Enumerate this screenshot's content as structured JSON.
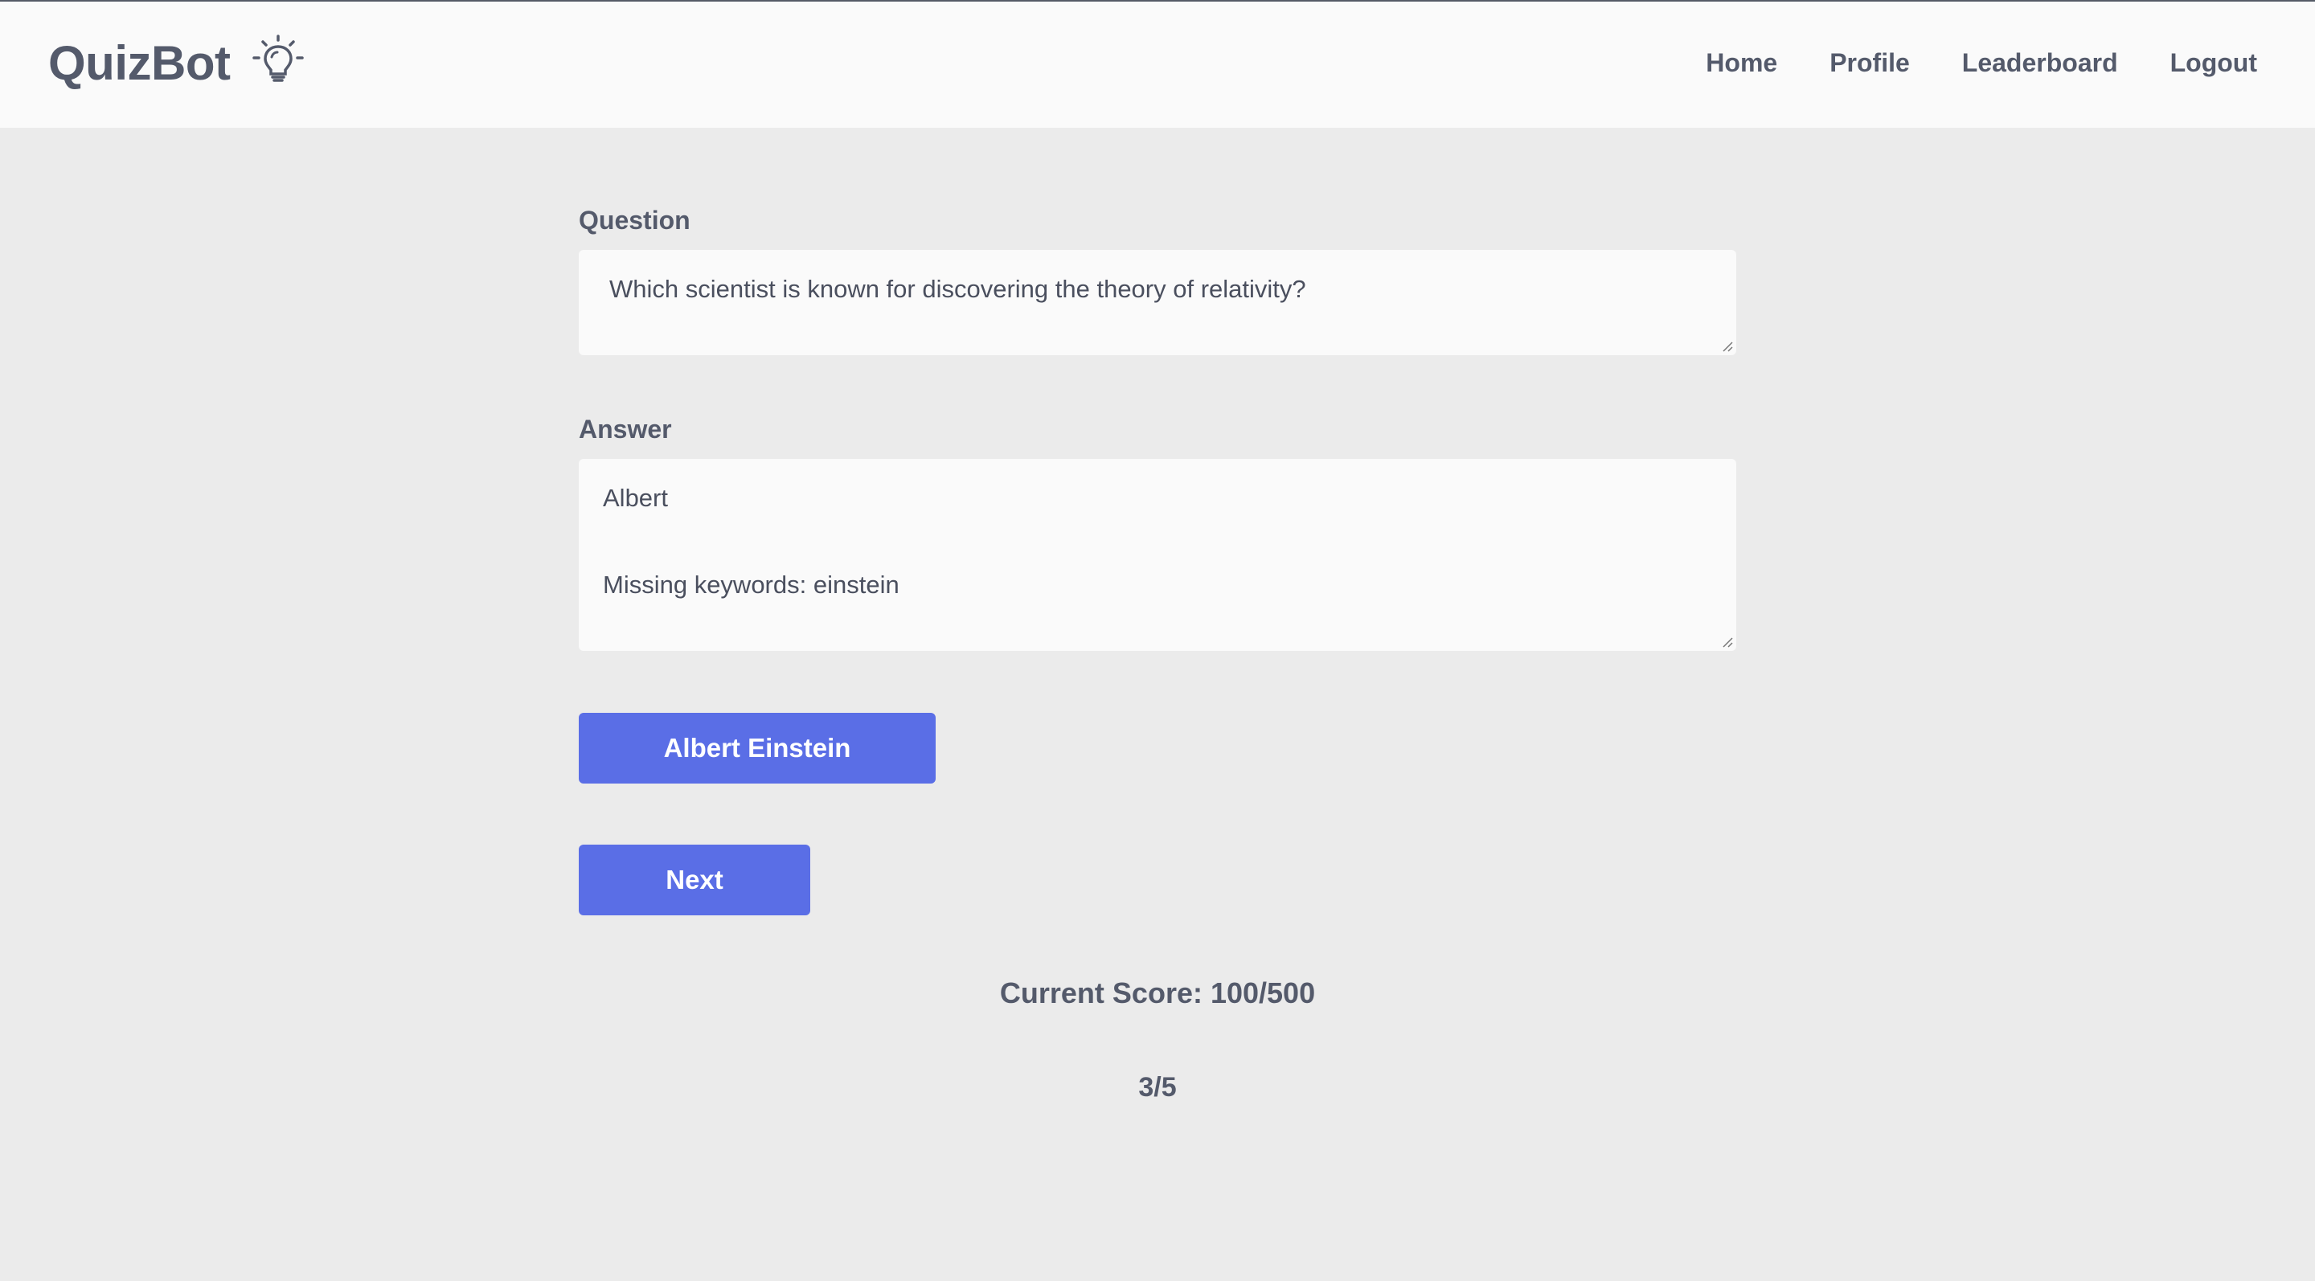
{
  "app": {
    "brand": "QuizBot",
    "brand_icon": "lightbulb-icon"
  },
  "nav": {
    "items": [
      {
        "label": "Home"
      },
      {
        "label": "Profile"
      },
      {
        "label": "Leaderboard"
      },
      {
        "label": "Logout"
      }
    ]
  },
  "quiz": {
    "question_label": "Question",
    "question_text": "Which scientist is known for discovering the theory of relativity?",
    "answer_label": "Answer",
    "answer_line1": "Albert",
    "answer_line2": "Missing keywords: einstein",
    "suggestion_button": "Albert Einstein",
    "next_button": "Next",
    "score_text": "Current Score: 100/500",
    "progress_text": "3/5"
  },
  "colors": {
    "accent": "#5a6ee6",
    "text": "#545a6b",
    "background": "#ebebeb",
    "navbar": "#fafafa"
  }
}
